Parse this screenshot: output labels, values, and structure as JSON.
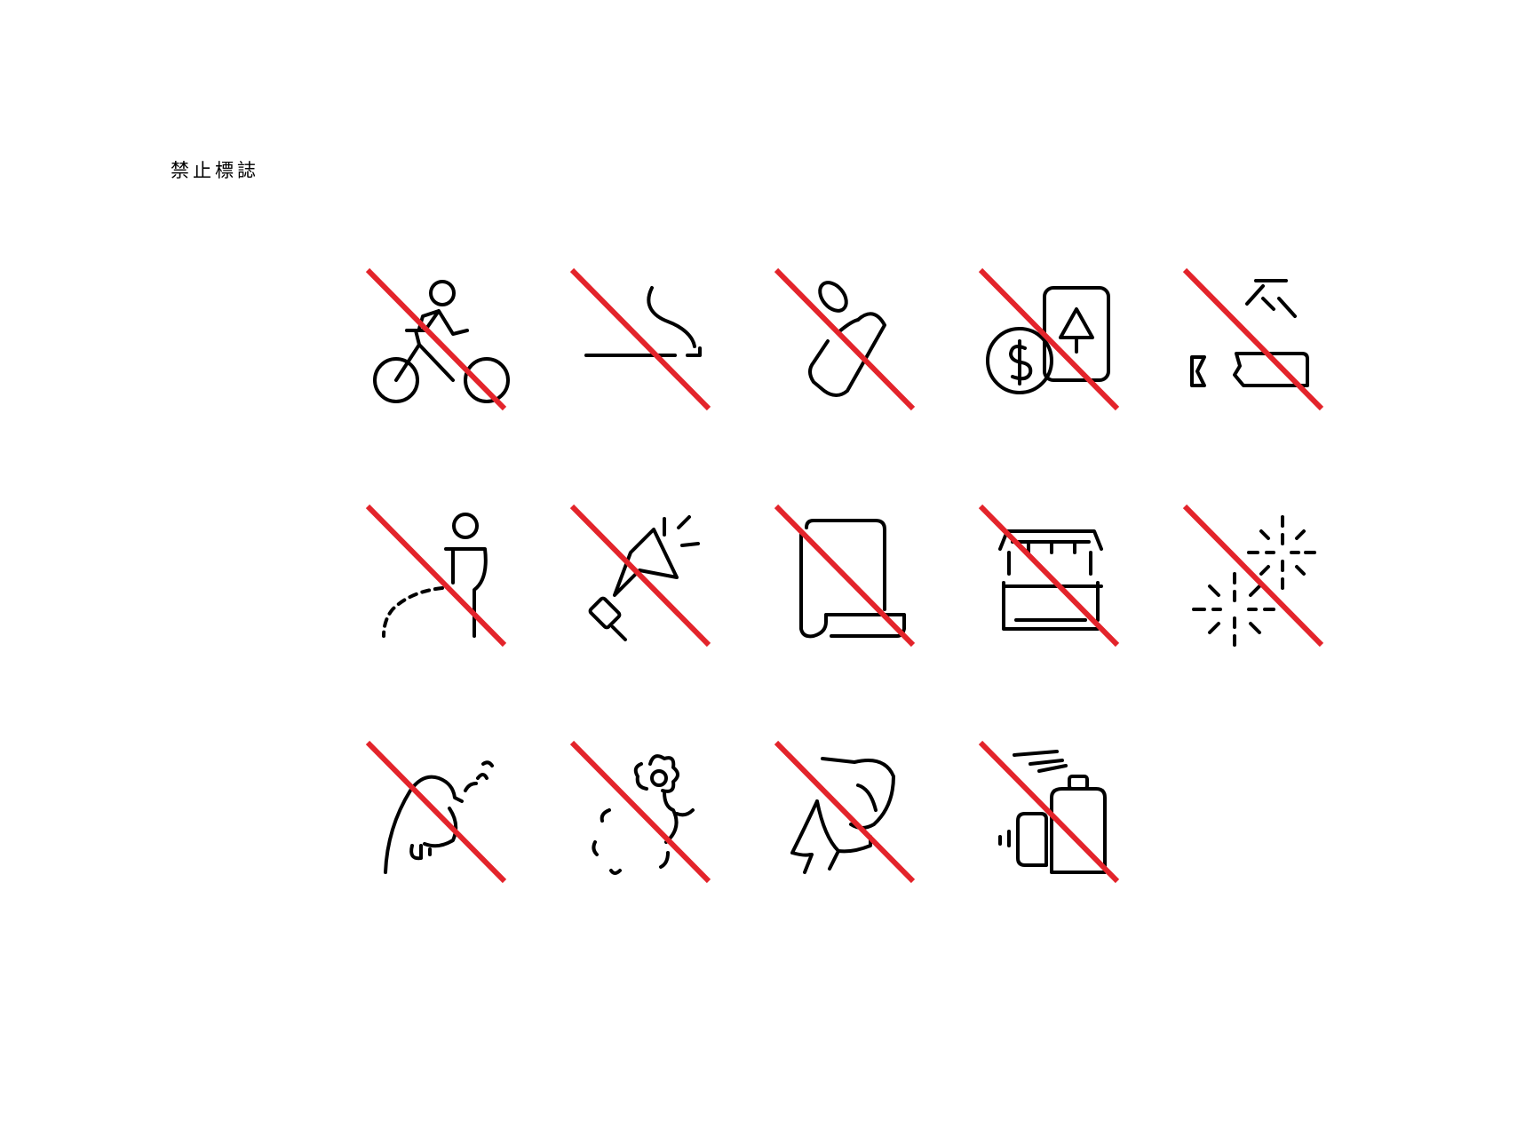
{
  "title": "禁止標誌",
  "colors": {
    "prohibition_slash": "#e3242b",
    "icon_stroke": "#000000",
    "background": "#ffffff"
  },
  "signs": [
    {
      "icon": "no-cycling-icon"
    },
    {
      "icon": "no-smoking-icon"
    },
    {
      "icon": "no-drinking-icon"
    },
    {
      "icon": "no-gambling-icon"
    },
    {
      "icon": "no-vandalism-icon"
    },
    {
      "icon": "no-urinating-icon"
    },
    {
      "icon": "no-loudspeaker-icon"
    },
    {
      "icon": "no-posting-icon"
    },
    {
      "icon": "no-street-vending-icon"
    },
    {
      "icon": "no-fireworks-icon"
    },
    {
      "icon": "no-spitting-icon"
    },
    {
      "icon": "no-flower-picking-icon"
    },
    {
      "icon": "no-feeding-birds-icon"
    },
    {
      "icon": "no-spray-painting-icon"
    }
  ]
}
